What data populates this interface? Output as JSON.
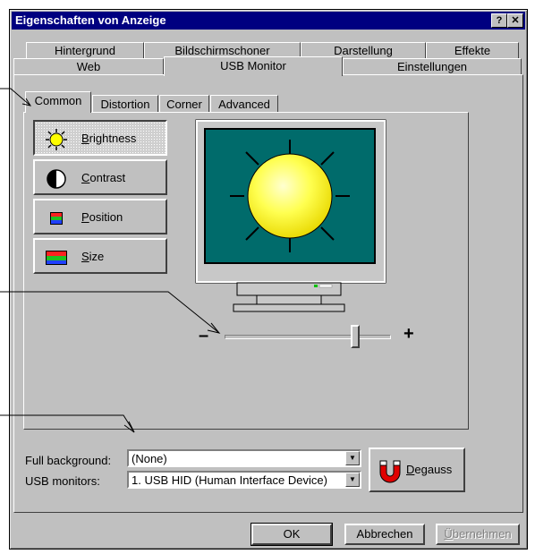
{
  "window": {
    "title": "Eigenschaften von Anzeige",
    "help_glyph": "?",
    "close_glyph": "✕"
  },
  "tabs_row1": [
    "Hintergrund",
    "Bildschirmschoner",
    "Darstellung",
    "Effekte"
  ],
  "tabs_row2": [
    "Web",
    "USB Monitor",
    "Einstellungen"
  ],
  "inner_tabs": [
    "Common",
    "Distortion",
    "Corner",
    "Advanced"
  ],
  "side_buttons": [
    {
      "key": "B",
      "rest": "rightness"
    },
    {
      "key": "C",
      "rest": "ontrast"
    },
    {
      "key": "P",
      "rest": "osition"
    },
    {
      "key": "S",
      "rest": "ize"
    }
  ],
  "slider": {
    "minus": "–",
    "plus": "+",
    "value_fraction": 0.81
  },
  "full_background": {
    "label": "Full background:",
    "value": "(None)"
  },
  "usb_monitors": {
    "label": "USB monitors:",
    "value": "1. USB HID (Human Interface Device)"
  },
  "degauss": {
    "key": "D",
    "rest": "egauss"
  },
  "buttons": {
    "ok": "OK",
    "cancel": "Abbrechen",
    "apply_key": "Ü",
    "apply_rest": "bernehmen"
  },
  "colors": {
    "title_bg": "#000080",
    "face": "#c0c0c0",
    "screen": "#006b6b",
    "sun": "#ffff40",
    "magnet": "#e00000"
  }
}
